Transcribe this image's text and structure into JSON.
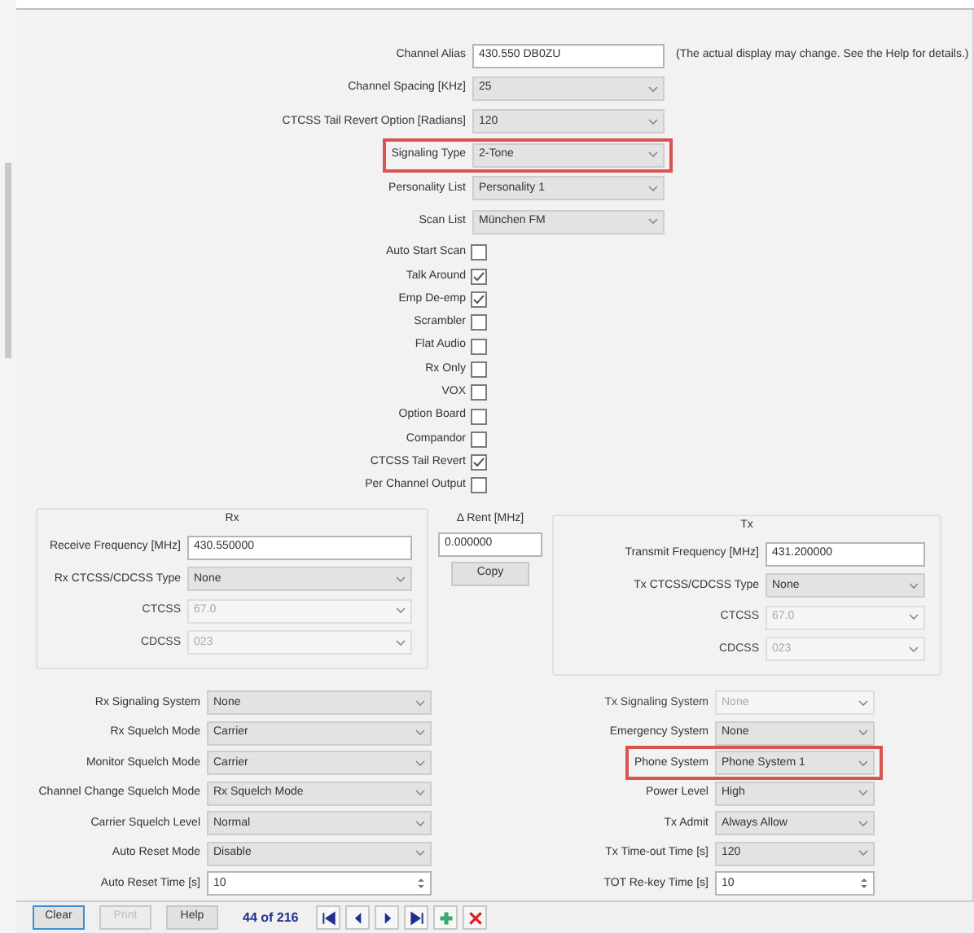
{
  "top_fields": [
    {
      "label": "Channel Alias",
      "kind": "text",
      "value": "430.550 DB0ZU",
      "highlighted": false,
      "note": "(The actual display may change. See the Help for details.)"
    },
    {
      "label": "Channel Spacing [KHz]",
      "kind": "select",
      "value": "25",
      "highlighted": false
    },
    {
      "label": "CTCSS Tail Revert Option [Radians]",
      "kind": "select",
      "value": "120",
      "highlighted": false
    },
    {
      "label": "Signaling Type",
      "kind": "select",
      "value": "2-Tone",
      "highlighted": true
    },
    {
      "label": "Personality List",
      "kind": "select",
      "value": "Personality 1",
      "highlighted": false
    },
    {
      "label": "Scan List",
      "kind": "select",
      "value": "München FM",
      "highlighted": false
    }
  ],
  "checkboxes": [
    {
      "label": "Auto Start Scan",
      "checked": false
    },
    {
      "label": "Talk Around",
      "checked": true
    },
    {
      "label": "Emp De-emp",
      "checked": true
    },
    {
      "label": "Scrambler",
      "checked": false
    },
    {
      "label": "Flat Audio",
      "checked": false
    },
    {
      "label": "Rx Only",
      "checked": false
    },
    {
      "label": "VOX",
      "checked": false
    },
    {
      "label": "Option Board",
      "checked": false
    },
    {
      "label": "Compandor",
      "checked": false
    },
    {
      "label": "CTCSS Tail Revert",
      "checked": true
    },
    {
      "label": "Per Channel Output",
      "checked": false
    }
  ],
  "rx": {
    "title": "Rx",
    "fields": [
      {
        "label": "Receive Frequency [MHz]",
        "kind": "text",
        "value": "430.550000",
        "disabled": false
      },
      {
        "label": "Rx CTCSS/CDCSS Type",
        "kind": "select",
        "value": "None",
        "disabled": false
      },
      {
        "label": "CTCSS",
        "kind": "select",
        "value": "67.0",
        "disabled": true
      },
      {
        "label": "CDCSS",
        "kind": "select",
        "value": "023",
        "disabled": true
      }
    ]
  },
  "offset": {
    "label": "Δ Rent [MHz]",
    "value": "0.000000",
    "button": "Copy"
  },
  "tx": {
    "title": "Tx",
    "fields": [
      {
        "label": "Transmit Frequency [MHz]",
        "kind": "text",
        "value": "431.200000",
        "disabled": false
      },
      {
        "label": "Tx CTCSS/CDCSS Type",
        "kind": "select",
        "value": "None",
        "disabled": false
      },
      {
        "label": "CTCSS",
        "kind": "select",
        "value": "67.0",
        "disabled": true
      },
      {
        "label": "CDCSS",
        "kind": "select",
        "value": "023",
        "disabled": true
      }
    ]
  },
  "rx_settings": [
    {
      "label": "Rx Signaling System",
      "kind": "select",
      "value": "None",
      "disabled": false,
      "highlighted": false
    },
    {
      "label": "Rx Squelch Mode",
      "kind": "select",
      "value": "Carrier",
      "disabled": false,
      "highlighted": false
    },
    {
      "label": "Monitor Squelch Mode",
      "kind": "select",
      "value": "Carrier",
      "disabled": false,
      "highlighted": false
    },
    {
      "label": "Channel Change Squelch Mode",
      "kind": "select",
      "value": "Rx Squelch Mode",
      "disabled": false,
      "highlighted": false
    },
    {
      "label": "Carrier Squelch Level",
      "kind": "select",
      "value": "Normal",
      "disabled": false,
      "highlighted": false
    },
    {
      "label": "Auto Reset Mode",
      "kind": "select",
      "value": "Disable",
      "disabled": false,
      "highlighted": false
    },
    {
      "label": "Auto Reset Time [s]",
      "kind": "spin",
      "value": "10",
      "disabled": false,
      "highlighted": false
    }
  ],
  "tx_settings": [
    {
      "label": "Tx Signaling System",
      "kind": "select",
      "value": "None",
      "disabled": true,
      "highlighted": false
    },
    {
      "label": "Emergency System",
      "kind": "select",
      "value": "None",
      "disabled": false,
      "highlighted": false
    },
    {
      "label": "Phone System",
      "kind": "select",
      "value": "Phone System 1",
      "disabled": false,
      "highlighted": true
    },
    {
      "label": "Power Level",
      "kind": "select",
      "value": "High",
      "disabled": false,
      "highlighted": false
    },
    {
      "label": "Tx Admit",
      "kind": "select",
      "value": "Always Allow",
      "disabled": false,
      "highlighted": false
    },
    {
      "label": "Tx Time-out Time [s]",
      "kind": "select",
      "value": "120",
      "disabled": false,
      "highlighted": false
    },
    {
      "label": "TOT Re-key Time [s]",
      "kind": "spin",
      "value": "10",
      "disabled": false,
      "highlighted": false
    }
  ],
  "footer": {
    "buttons": [
      {
        "label": "Clear",
        "disabled": false,
        "selected": true
      },
      {
        "label": "Print",
        "disabled": true,
        "selected": false
      },
      {
        "label": "Help",
        "disabled": false,
        "selected": false
      }
    ],
    "record": "44 of 216",
    "nav": [
      {
        "kind": "first"
      },
      {
        "kind": "prev"
      },
      {
        "kind": "next"
      },
      {
        "kind": "last"
      },
      {
        "kind": "add"
      },
      {
        "kind": "delete"
      }
    ]
  }
}
